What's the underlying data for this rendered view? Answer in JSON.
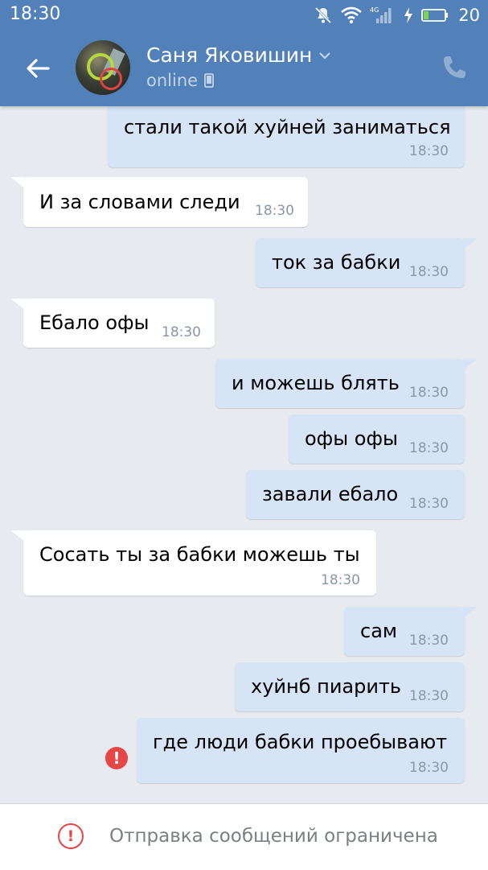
{
  "status_bar": {
    "time": "18:30",
    "network": "4G",
    "battery_level": "20",
    "icons": [
      "mute-icon",
      "wifi-icon",
      "signal-icon",
      "charging-icon",
      "battery-icon"
    ]
  },
  "header": {
    "contact_name": "Саня Яковишин",
    "contact_status": "online",
    "icons": [
      "back-arrow-icon",
      "chevron-down-icon",
      "mobile-phone-icon",
      "call-icon"
    ]
  },
  "messages": [
    {
      "direction": "out",
      "text": "стали такой хуйней заниматься",
      "time": "18:30"
    },
    {
      "direction": "in",
      "text": "И за словами следи",
      "time": "18:30"
    },
    {
      "direction": "out",
      "text": "ток за бабки",
      "time": "18:30"
    },
    {
      "direction": "in",
      "text": "Ебало офы",
      "time": "18:30"
    },
    {
      "direction": "out",
      "text": "и можешь блять",
      "time": "18:30"
    },
    {
      "direction": "out",
      "text": "офы офы",
      "time": "18:30"
    },
    {
      "direction": "out",
      "text": "завали ебало",
      "time": "18:30"
    },
    {
      "direction": "in",
      "text": "Сосать ты за бабки можешь ты",
      "time": "18:30"
    },
    {
      "direction": "out",
      "text": "сам",
      "time": "18:30"
    },
    {
      "direction": "out",
      "text": "хуйнб пиарить",
      "time": "18:30"
    },
    {
      "direction": "out",
      "text": "где люди бабки проебывают",
      "time": "18:30",
      "failed": true
    }
  ],
  "bottom_bar": {
    "restriction_text": "Отправка сообщений ограничена"
  },
  "colors": {
    "header_bg": "#5181b8",
    "chat_bg": "#e7ebf0",
    "outgoing_bubble": "#d6e4f5",
    "incoming_bubble": "#ffffff",
    "error_red": "#e64646",
    "timestamp_gray": "#8b97a6"
  }
}
